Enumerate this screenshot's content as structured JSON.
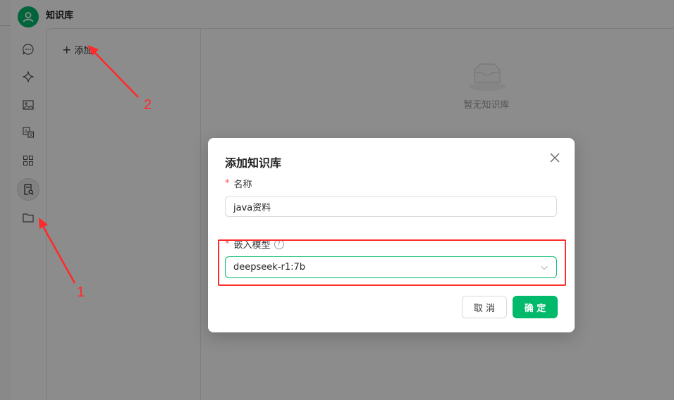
{
  "app": {
    "title": "知识库"
  },
  "sidebar": {
    "items": [
      {
        "icon": "chat-bubble-icon"
      },
      {
        "icon": "sparkle-icon"
      },
      {
        "icon": "image-icon"
      },
      {
        "icon": "translate-icon"
      },
      {
        "icon": "grid-apps-icon"
      },
      {
        "icon": "knowledge-base-icon",
        "active": true
      },
      {
        "icon": "folder-icon"
      }
    ]
  },
  "list_panel": {
    "add_label": "添加"
  },
  "content": {
    "empty_text": "暂无知识库"
  },
  "modal": {
    "title": "添加知识库",
    "name_label": "名称",
    "name_value": "java资料",
    "model_label": "嵌入模型",
    "model_value": "deepseek-r1:7b",
    "cancel_label": "取 消",
    "ok_label": "确 定"
  },
  "annotations": {
    "label_1": "1",
    "label_2": "2",
    "color": "#ff2a2a"
  },
  "colors": {
    "accent": "#00b96b"
  }
}
